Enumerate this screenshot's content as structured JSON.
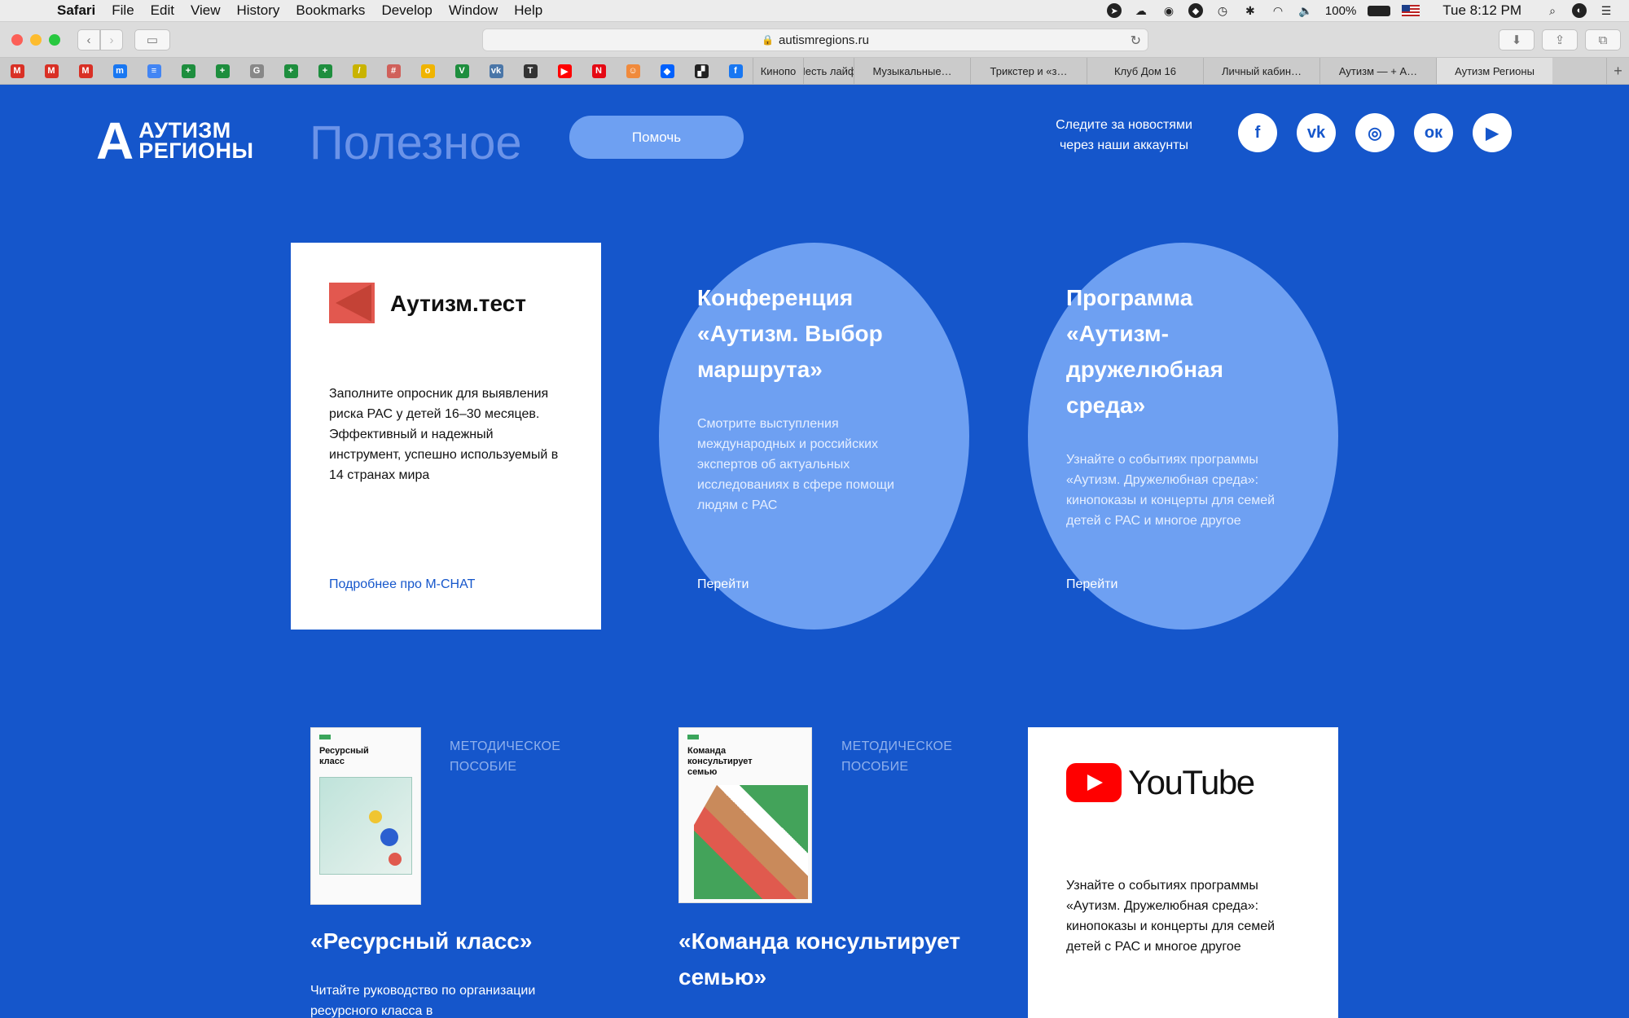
{
  "menubar": {
    "app": "Safari",
    "items": [
      "File",
      "Edit",
      "View",
      "History",
      "Bookmarks",
      "Develop",
      "Window",
      "Help"
    ],
    "battery": "100%",
    "clock": "Tue 8:12 PM"
  },
  "browser": {
    "url": "autismregions.ru",
    "favicons": [
      {
        "icon": "gmail-icon",
        "glyph": "M",
        "color": "#d93025"
      },
      {
        "icon": "gmail-icon",
        "glyph": "M",
        "color": "#d93025"
      },
      {
        "icon": "gmail-icon",
        "glyph": "M",
        "color": "#d93025"
      },
      {
        "icon": "messenger-icon",
        "glyph": "m",
        "color": "#1877f2"
      },
      {
        "icon": "docs-icon",
        "glyph": "≡",
        "color": "#4285f4"
      },
      {
        "icon": "sheets-icon",
        "glyph": "+",
        "color": "#1e8e3e"
      },
      {
        "icon": "sheets-icon",
        "glyph": "+",
        "color": "#1e8e3e"
      },
      {
        "icon": "generic-icon",
        "glyph": "G",
        "color": "#888888"
      },
      {
        "icon": "sheets-icon",
        "glyph": "+",
        "color": "#1e8e3e"
      },
      {
        "icon": "sheets-icon",
        "glyph": "+",
        "color": "#1e8e3e"
      },
      {
        "icon": "stripes-icon",
        "glyph": "/",
        "color": "#c9b300"
      },
      {
        "icon": "pattern-icon",
        "glyph": "#",
        "color": "#d0605a"
      },
      {
        "icon": "cloud-icon",
        "glyph": "o",
        "color": "#f0b400"
      },
      {
        "icon": "vector-icon",
        "glyph": "V",
        "color": "#1e8e3e"
      },
      {
        "icon": "vk-icon",
        "glyph": "vk",
        "color": "#4a76a8"
      },
      {
        "icon": "t-icon",
        "glyph": "T",
        "color": "#333333"
      },
      {
        "icon": "youtube-icon",
        "glyph": "▶",
        "color": "#ff0000"
      },
      {
        "icon": "netflix-icon",
        "glyph": "N",
        "color": "#e50914"
      },
      {
        "icon": "face-icon",
        "glyph": "☺",
        "color": "#f08a3c"
      },
      {
        "icon": "dropbox-icon",
        "glyph": "◆",
        "color": "#0061fe"
      },
      {
        "icon": "dark-icon",
        "glyph": "▞",
        "color": "#222222"
      },
      {
        "icon": "facebook-icon",
        "glyph": "f",
        "color": "#1877f2"
      }
    ],
    "tabs": [
      {
        "label": "Кинопо",
        "kind": "small"
      },
      {
        "label": "Шесть лайфх",
        "kind": "small"
      },
      {
        "label": "Музыкальные…",
        "kind": "normal"
      },
      {
        "label": "Трикстер и «з…",
        "kind": "normal"
      },
      {
        "label": "Клуб Дом 16",
        "kind": "normal"
      },
      {
        "label": "Личный кабин…",
        "kind": "normal"
      },
      {
        "label": "Аутизм — + А…",
        "kind": "normal"
      },
      {
        "label": "Аутизм Регионы",
        "kind": "active"
      }
    ]
  },
  "header": {
    "logo_line1": "АУТИЗМ",
    "logo_line2": "РЕГИОНЫ",
    "logo_letter": "А",
    "page_title": "Полезное",
    "help_button": "Помочь",
    "follow_line1": "Следите за новостями",
    "follow_line2": "через наши аккаунты",
    "socials": [
      {
        "name": "facebook-icon",
        "glyph": "f"
      },
      {
        "name": "vk-icon",
        "glyph": "vk"
      },
      {
        "name": "instagram-icon",
        "glyph": "◎"
      },
      {
        "name": "odnoklassniki-icon",
        "glyph": "ок"
      },
      {
        "name": "youtube-icon",
        "glyph": "▶"
      }
    ]
  },
  "cards": {
    "test": {
      "brand": "Аутизм.тест",
      "desc": "Заполните опросник для выявления риска РАС у детей 16–30 месяцев. Эффективный и надежный инструмент, успешно используемый в 14 странах мира",
      "link": "Подробнее про M-CHAT"
    },
    "conference": {
      "title": "Конференция «Аутизм. Выбор маршрута»",
      "desc": "Смотрите выступления международных и российских экспертов об актуальных исследованиях в сфере помощи людям с РАС",
      "link": "Перейти"
    },
    "program": {
      "title": "Программа «Аутизм-дружелюбная среда»",
      "desc": "Узнайте о событиях программы «Аутизм. Дружелюбная среда»: кинопоказы и концерты для семей детей с РАС и многое другое",
      "link": "Перейти"
    }
  },
  "books": [
    {
      "cover_title": "Ресурсный класс",
      "tag_line1": "МЕТОДИЧЕСКОЕ",
      "tag_line2": "ПОСОБИЕ",
      "title": "«Ресурсный класс»",
      "desc": "Читайте руководство по организации ресурсного класса в"
    },
    {
      "cover_title": "Команда консультирует семью",
      "tag_line1": "МЕТОДИЧЕСКОЕ",
      "tag_line2": "ПОСОБИЕ",
      "title": "«Команда консультирует семью»"
    }
  ],
  "youtube_card": {
    "wordmark": "YouTube",
    "desc": "Узнайте о событиях программы «Аутизм. Дружелюбная среда»: кинопоказы и концерты для семей детей с РАС и многое другое"
  },
  "colors": {
    "page_bg": "#1556cb",
    "card_light": "#6ea0f2",
    "accent_red": "#e2584f",
    "youtube_red": "#ff0000"
  }
}
